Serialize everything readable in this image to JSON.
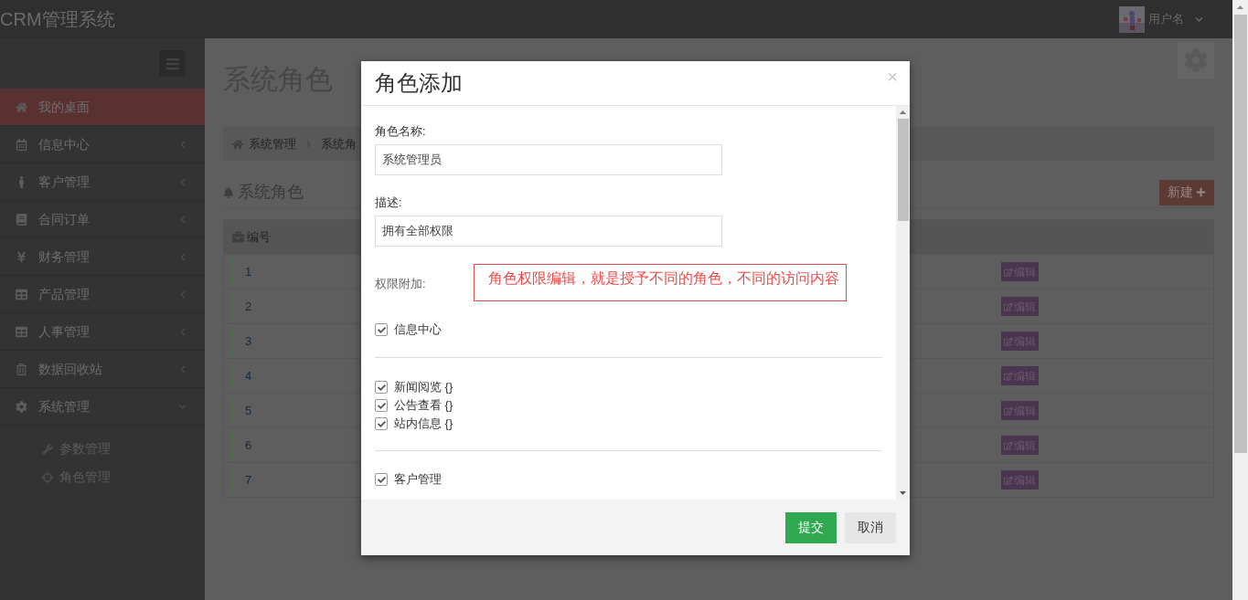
{
  "topbar": {
    "brand": "CRM管理系统",
    "user": {
      "name": "用户名"
    }
  },
  "sidebar": {
    "items": [
      {
        "label": "我的桌面",
        "selected": true
      },
      {
        "label": "信息中心",
        "selected": false,
        "expanded": false
      },
      {
        "label": "客户管理",
        "selected": false,
        "expanded": false
      },
      {
        "label": "合同订单",
        "selected": false,
        "expanded": false
      },
      {
        "label": "财务管理",
        "selected": false,
        "expanded": false
      },
      {
        "label": "产品管理",
        "selected": false,
        "expanded": false
      },
      {
        "label": "人事管理",
        "selected": false,
        "expanded": false
      },
      {
        "label": "数据回收站",
        "selected": false,
        "expanded": false
      },
      {
        "label": "系统管理",
        "selected": false,
        "expanded": true,
        "children": [
          {
            "label": "参数管理"
          },
          {
            "label": "角色管理"
          }
        ]
      }
    ]
  },
  "page": {
    "title": "系统角色",
    "breadcrumb": [
      "系统管理",
      "系统角"
    ],
    "section_title": "系统角色",
    "new_button": "新建",
    "table": {
      "columns": [
        "编号"
      ],
      "rows": [
        {
          "id": "1",
          "action": "编辑"
        },
        {
          "id": "2",
          "action": "编辑"
        },
        {
          "id": "3",
          "action": "编辑"
        },
        {
          "id": "4",
          "action": "编辑"
        },
        {
          "id": "5",
          "action": "编辑"
        },
        {
          "id": "6",
          "action": "编辑"
        },
        {
          "id": "7",
          "action": "编辑"
        }
      ]
    }
  },
  "dialog": {
    "title": "角色添加",
    "close": "×",
    "fields": [
      {
        "label": "角色名称:",
        "value": "系统管理员"
      },
      {
        "label": "描述:",
        "value": "拥有全部权限"
      }
    ],
    "permissions_label": "权限附加:",
    "annotation": "角色权限编辑，就是授予不同的角色，不同的访问内容",
    "permissions": [
      {
        "label": "信息中心",
        "checked": true,
        "children": [
          {
            "label": "新闻阅览 {}",
            "checked": true
          },
          {
            "label": "公告查看 {}",
            "checked": true
          },
          {
            "label": "站内信息 {}",
            "checked": true
          }
        ]
      },
      {
        "label": "客户管理",
        "checked": true
      }
    ],
    "buttons": [
      {
        "label": "提交",
        "kind": "primary"
      },
      {
        "label": "取消",
        "kind": "default"
      }
    ]
  }
}
